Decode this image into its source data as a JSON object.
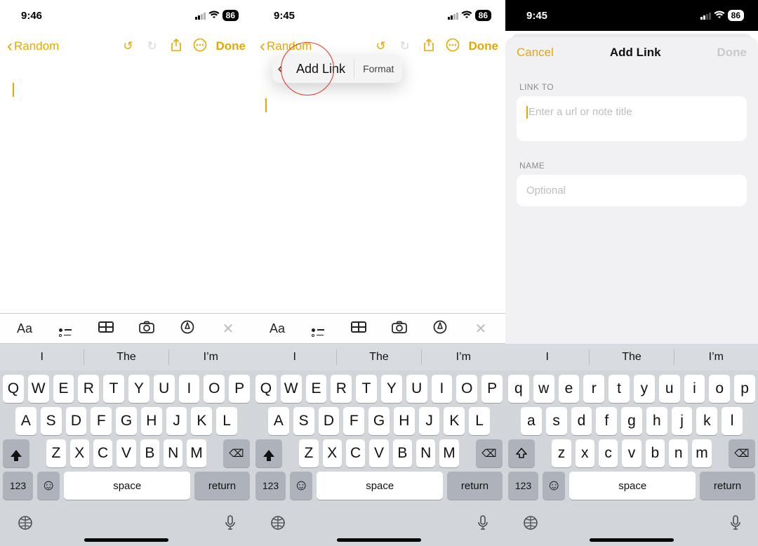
{
  "status": {
    "time1": "9:46",
    "time2": "9:45",
    "time3": "9:45",
    "battery": "86"
  },
  "nav": {
    "back_label": "Random",
    "done": "Done"
  },
  "popover": {
    "addlink": "Add Link",
    "format": "Format"
  },
  "fmt": {
    "aa": "Aa"
  },
  "sheet": {
    "cancel": "Cancel",
    "title": "Add Link",
    "done": "Done",
    "group1": "LINK TO",
    "placeholder1": "Enter a url or note title",
    "group2": "NAME",
    "placeholder2": "Optional"
  },
  "sugg": {
    "s1": "I",
    "s2": "The",
    "s3": "I’m"
  },
  "keys_upper": {
    "r1": [
      "Q",
      "W",
      "E",
      "R",
      "T",
      "Y",
      "U",
      "I",
      "O",
      "P"
    ],
    "r2": [
      "A",
      "S",
      "D",
      "F",
      "G",
      "H",
      "J",
      "K",
      "L"
    ],
    "r3": [
      "Z",
      "X",
      "C",
      "V",
      "B",
      "N",
      "M"
    ]
  },
  "keys_lower": {
    "r1": [
      "q",
      "w",
      "e",
      "r",
      "t",
      "y",
      "u",
      "i",
      "o",
      "p"
    ],
    "r2": [
      "a",
      "s",
      "d",
      "f",
      "g",
      "h",
      "j",
      "k",
      "l"
    ],
    "r3": [
      "z",
      "x",
      "c",
      "v",
      "b",
      "n",
      "m"
    ]
  },
  "kb": {
    "num": "123",
    "space": "space",
    "ret": "return"
  }
}
